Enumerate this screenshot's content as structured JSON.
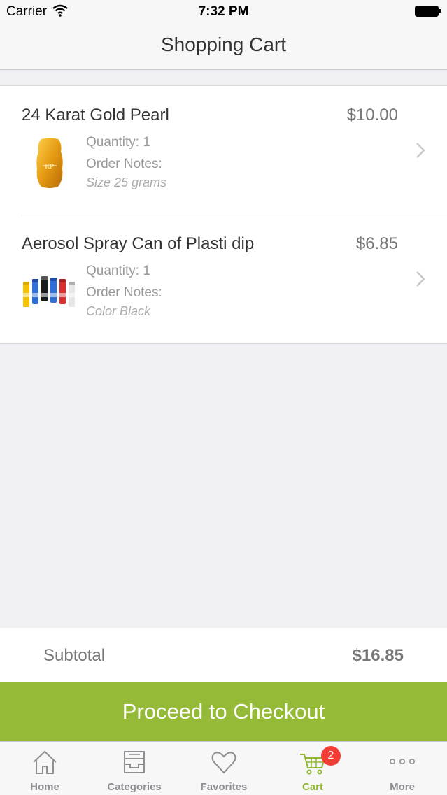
{
  "status_bar": {
    "carrier": "Carrier",
    "time": "7:32 PM"
  },
  "nav": {
    "title": "Shopping Cart"
  },
  "cart": {
    "items": [
      {
        "name": "24 Karat Gold Pearl",
        "price": "$10.00",
        "quantity": "Quantity: 1",
        "notes_label": "Order Notes:",
        "notes_value": "Size 25 grams"
      },
      {
        "name": "Aerosol Spray Can of Plasti dip",
        "price": "$6.85",
        "quantity": "Quantity: 1",
        "notes_label": "Order Notes:",
        "notes_value": "Color Black"
      }
    ]
  },
  "summary": {
    "subtotal_label": "Subtotal",
    "subtotal_value": "$16.85",
    "checkout_label": "Proceed to Checkout"
  },
  "tabs": {
    "items": [
      {
        "label": "Home",
        "icon": "home-icon"
      },
      {
        "label": "Categories",
        "icon": "categories-icon"
      },
      {
        "label": "Favorites",
        "icon": "heart-icon"
      },
      {
        "label": "Cart",
        "icon": "cart-icon"
      },
      {
        "label": "More",
        "icon": "more-icon"
      }
    ],
    "active": "Cart",
    "cart_badge": "2"
  },
  "colors": {
    "accent": "#94ba37",
    "active_tab": "#8fb735",
    "badge": "#f23c35",
    "background": "#efeff4"
  }
}
